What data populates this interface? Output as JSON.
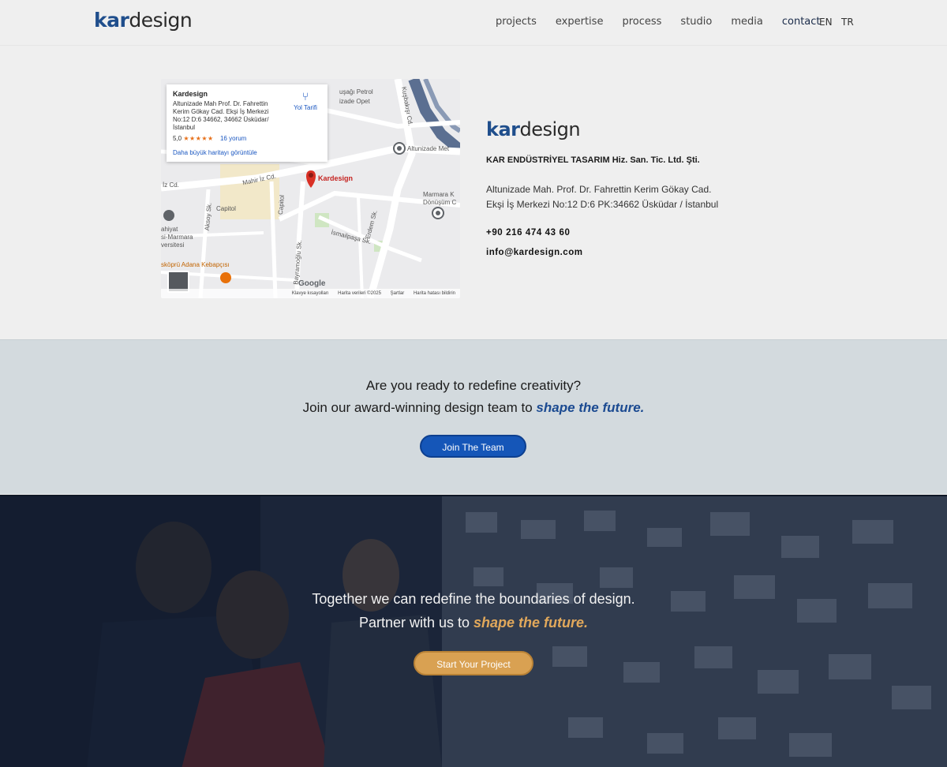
{
  "header": {
    "logo_kar": "kar",
    "logo_design": "design",
    "nav": [
      {
        "label": "projects"
      },
      {
        "label": "expertise"
      },
      {
        "label": "process"
      },
      {
        "label": "studio"
      },
      {
        "label": "media"
      },
      {
        "label": "contact"
      }
    ],
    "lang_en": "EN",
    "lang_tr": "TR"
  },
  "map": {
    "card_title": "Kardesign",
    "card_address": "Altunizade Mah Prof. Dr. Fahrettin Kerim Gökay Cad. Ekşi İş Merkezi No:12 D:6 34662, 34662 Üsküdar/ İstanbul",
    "rating": "5,0",
    "stars": "★★★★★",
    "reviews": "16 yorum",
    "larger_map_link": "Daha büyük haritayı görüntüle",
    "directions": "Yol Tarifi",
    "pin_label": "Kardesign",
    "labels": {
      "mahir_iz": "Mahir İz Cd.",
      "iz_cd": "İz Cd.",
      "capitol": "Capitol",
      "capitol_street": "Capitol",
      "aksoy": "Aksoy Sk.",
      "kusbakisi": "Kuşbakışı Cd.",
      "altunizade_metro": "Altunizade Met",
      "marmara": "Marmara K",
      "donusum": "Dönüşüm C",
      "erdem": "Erdem Sk.",
      "ismailpasa": "İsmailpaşa Sk.",
      "bayramoglu": "Bayramoğlu Sk.",
      "petrol": "uşağı Petrol",
      "opet": "izade Opet",
      "kebap": "sköprü Adana Kebapçısı",
      "university1": "ahiyat",
      "university2": "si-Marmara",
      "university3": "versitesi"
    },
    "zoom_in": "+",
    "zoom_out": "−",
    "google": "Google",
    "footer": [
      "Klavye kısayolları",
      "Harita verileri ©2025",
      "Şartlar",
      "Harita hatası bildirin"
    ]
  },
  "contact": {
    "logo_kar": "kar",
    "logo_design": "design",
    "company_name": "KAR ENDÜSTRİYEL TASARIM Hiz. San. Tic. Ltd. Şti.",
    "address_line1": "Altunizade Mah. Prof. Dr. Fahrettin Kerim Gökay Cad.",
    "address_line2": "Ekşi İş Merkezi No:12 D:6  PK:34662 Üsküdar / İstanbul",
    "phone": "+90 216 474 43 60",
    "email": "info@kardesign.com"
  },
  "join": {
    "line1": "Are you ready to redefine creativity?",
    "line2_prefix": "Join our award-winning design team to ",
    "line2_emphasis": "shape the future.",
    "button": "Join The Team"
  },
  "project": {
    "line1": "Together we can redefine the boundaries of design.",
    "line2_prefix": "Partner with us to ",
    "line2_emphasis": "shape the future.",
    "button": "Start Your Project"
  },
  "colors": {
    "brand_blue": "#1f4e8c",
    "join_button": "#1556b8",
    "project_button": "#d9a152",
    "accent_gold": "#e1a85b"
  }
}
